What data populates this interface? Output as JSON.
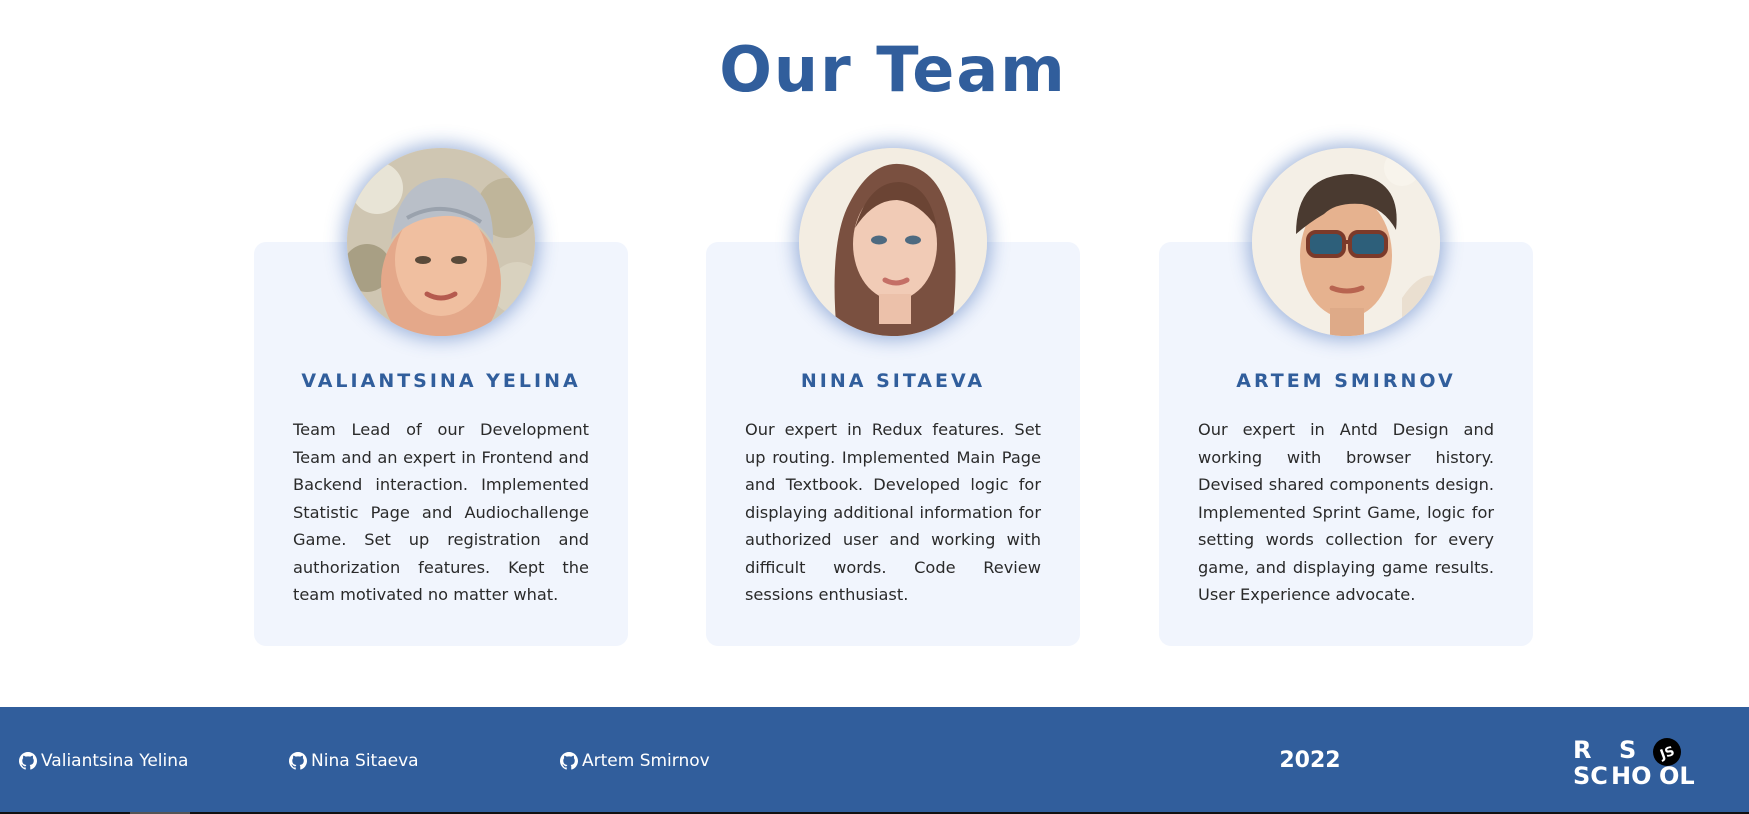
{
  "colors": {
    "accent": "#315e9c",
    "card_background": "#f1f5fd",
    "footer_text": "#ffffff",
    "body_text": "#2a2a2a"
  },
  "page": {
    "title": "Our Team"
  },
  "team": [
    {
      "name": "VALIANTSINA YELINA",
      "bio": "Team Lead of our Development Team and an expert in Frontend and Backend interaction. Implemented Statistic Page and Audiochallenge Game. Set up registration and authorization features. Kept the team motivated no matter what.",
      "avatar_icon": "avatar-portrait-woman-turban"
    },
    {
      "name": "NINA SITAEVA",
      "bio": "Our expert in Redux features. Set up routing. Implemented Main Page and Textbook. Developed logic for displaying additional information for authorized user and working with difficult words. Code Review sessions enthusiast.",
      "avatar_icon": "avatar-portrait-woman-long-hair"
    },
    {
      "name": "ARTEM SMIRNOV",
      "bio": "Our expert in Antd Design and working with browser history. Devised shared components design. Implemented Sprint Game, logic for setting words collection for every game, and displaying game results. User Experience advocate.",
      "avatar_icon": "avatar-portrait-man-sunglasses"
    }
  ],
  "footer": {
    "links": [
      {
        "label": "Valiantsina Yelina",
        "icon": "github-icon"
      },
      {
        "label": "Nina Sitaeva",
        "icon": "github-icon"
      },
      {
        "label": "Artem Smirnov",
        "icon": "github-icon"
      }
    ],
    "year": "2022",
    "logo": {
      "icon": "rs-school-logo",
      "text": "RS SCHOOL JS"
    }
  }
}
